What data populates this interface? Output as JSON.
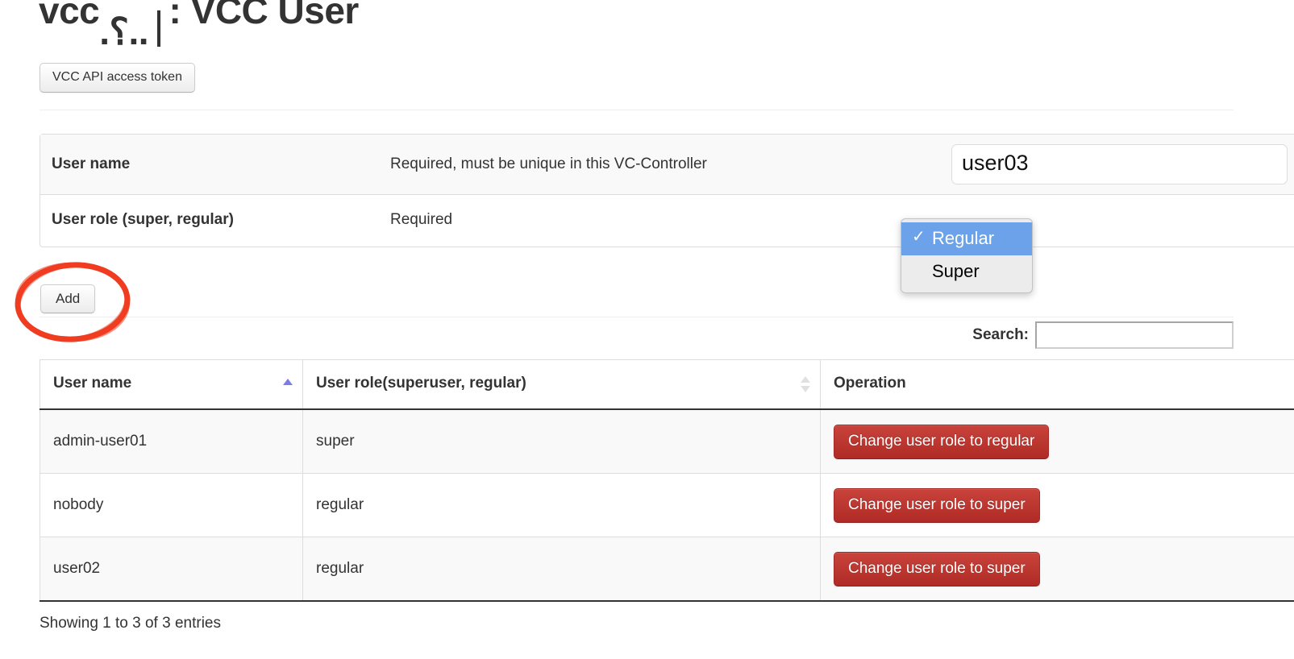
{
  "page": {
    "title_prefix": "vcc",
    "title_clipped": ".⸮..⏐",
    "title_suffix": ": VCC User",
    "token_button_label": "VCC API access token",
    "add_button_label": "Add",
    "info_text": "Showing 1 to 3 of 3 entries"
  },
  "form": {
    "rows": [
      {
        "label": "User name",
        "description": "Required, must be unique in this VC-Controller",
        "field_type": "text",
        "value": "user03",
        "placeholder": ""
      },
      {
        "label": "User role (super, regular)",
        "description": "Required",
        "field_type": "select",
        "value": "Regular"
      }
    ]
  },
  "role_dropdown": {
    "open": true,
    "selected": "Regular",
    "check_glyph": "✓",
    "options": [
      {
        "label": "Regular",
        "selected": true
      },
      {
        "label": "Super",
        "selected": false
      }
    ]
  },
  "search": {
    "label": "Search:",
    "value": "",
    "placeholder": ""
  },
  "users_table": {
    "columns": [
      {
        "label": "User name",
        "sort": "asc"
      },
      {
        "label": "User role(superuser, regular)",
        "sort": "none"
      },
      {
        "label": "Operation",
        "sort": "none"
      }
    ],
    "rows": [
      {
        "username": "admin-user01",
        "role": "super",
        "operation_label": "Change user role to regular"
      },
      {
        "username": "nobody",
        "role": "regular",
        "operation_label": "Change user role to super"
      },
      {
        "username": "user02",
        "role": "regular",
        "operation_label": "Change user role to super"
      }
    ]
  },
  "annotation": {
    "shape": "ellipse",
    "color": "#f03c20",
    "target": "add-button"
  },
  "colors": {
    "danger": "#b02b25",
    "select_highlight": "#6ba2ea",
    "sort_active": "#7b7bea",
    "annotation": "#f03c20"
  }
}
